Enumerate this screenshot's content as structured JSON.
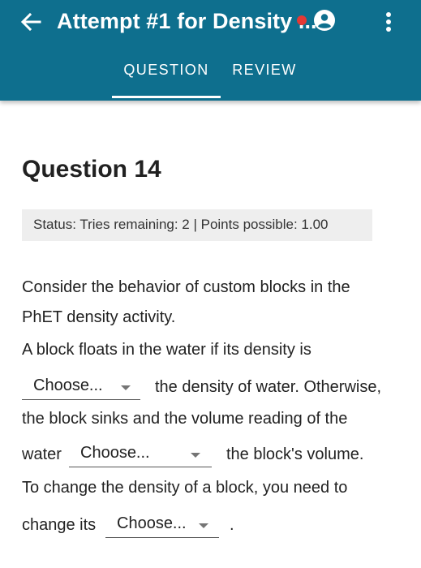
{
  "appbar": {
    "title": "Attempt #1 for Density ...",
    "back_icon": "arrow-left-icon",
    "account_icon": "account-circle-icon",
    "menu_icon": "more-vert-icon",
    "notification_color": "#e53935",
    "background_color": "#0e6f8e"
  },
  "tabs": [
    {
      "label": "QUESTION",
      "active": true
    },
    {
      "label": "REVIEW",
      "active": false
    }
  ],
  "question": {
    "heading": "Question 14",
    "status": "Status: Tries remaining: 2 | Points possible: 1.00",
    "lines": {
      "l1": "Consider the behavior of custom blocks in the",
      "l2": "PhET density activity.",
      "l3": "A block floats in the water if its density is",
      "l4_after": "the density of water. Otherwise,",
      "l5": "the block sinks and the volume reading of the",
      "l6_before": "water",
      "l6_after": "the block's volume.",
      "l7": "To change the density of a block, you need to",
      "l8_before": "change its",
      "l8_after": "."
    },
    "dropdowns": [
      {
        "value": "Choose..."
      },
      {
        "value": "Choose..."
      },
      {
        "value": "Choose..."
      }
    ]
  }
}
